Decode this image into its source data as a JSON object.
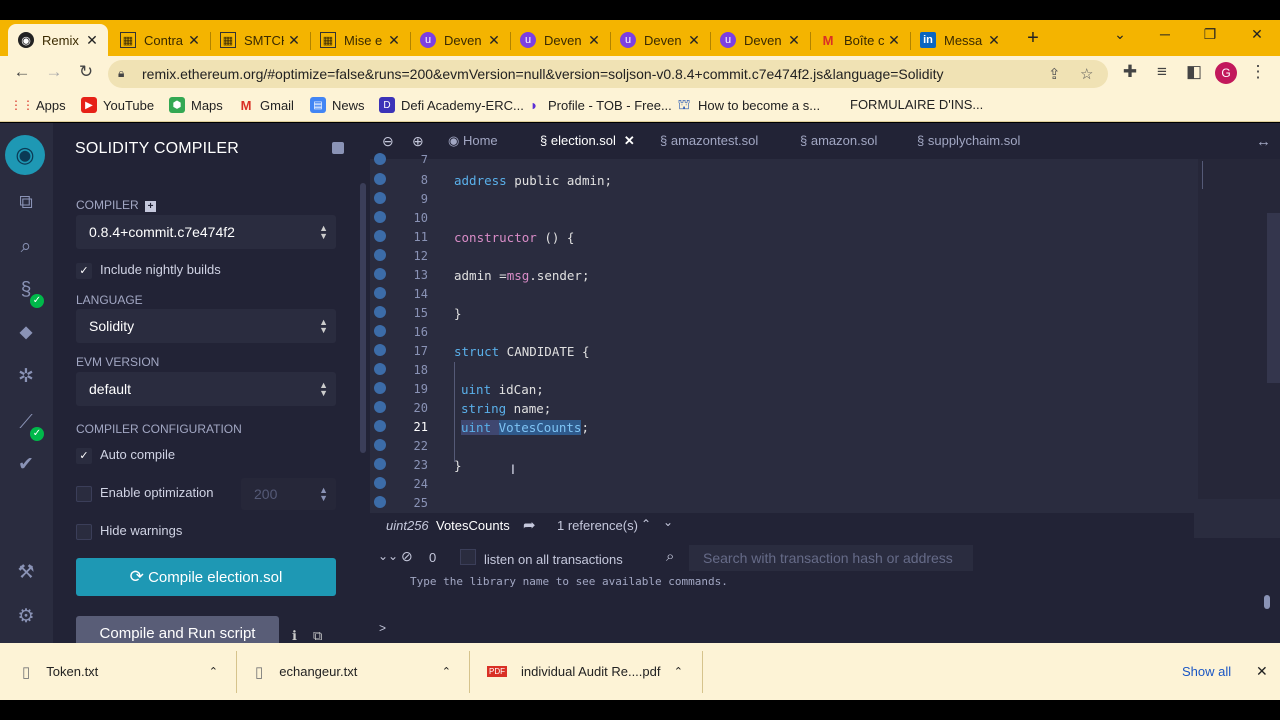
{
  "browser": {
    "tabs": [
      {
        "label": "Remix",
        "icon": "remix-icon",
        "active": true
      },
      {
        "label": "Contra",
        "icon": "doc-icon"
      },
      {
        "label": "SMTCH",
        "icon": "doc-icon"
      },
      {
        "label": "Mise e",
        "icon": "doc-icon"
      },
      {
        "label": "Deven",
        "icon": "purple-icon"
      },
      {
        "label": "Deven",
        "icon": "purple-icon"
      },
      {
        "label": "Deven",
        "icon": "purple-icon"
      },
      {
        "label": "Deven",
        "icon": "purple-icon"
      },
      {
        "label": "Boîte c",
        "icon": "gmail-icon"
      },
      {
        "label": "Messa",
        "icon": "linkedin-icon"
      }
    ],
    "url": "remix.ethereum.org/#optimize=false&runs=200&evmVersion=null&version=soljson-v0.8.4+commit.c7e474f2.js&language=Solidity",
    "avatar_letter": "G",
    "bookmarks": [
      "Apps",
      "YouTube",
      "Maps",
      "Gmail",
      "News",
      "Defi Academy-ERC...",
      "Profile - TOB - Free...",
      "How to become a s...",
      "FORMULAIRE D'INS..."
    ]
  },
  "sidebar": {
    "title": "SOLIDITY COMPILER",
    "compiler_label": "COMPILER",
    "compiler_value": "0.8.4+commit.c7e474f2",
    "nightly_label": "Include nightly builds",
    "language_label": "LANGUAGE",
    "language_value": "Solidity",
    "evm_label": "EVM VERSION",
    "evm_value": "default",
    "config_label": "COMPILER CONFIGURATION",
    "auto_compile_label": "Auto compile",
    "optimization_label": "Enable optimization",
    "runs_value": "200",
    "hide_warnings_label": "Hide warnings",
    "compile_button": "Compile election.sol",
    "run_button": "Compile and Run script"
  },
  "editor": {
    "home_tab": "Home",
    "file_tabs": [
      "election.sol",
      "amazontest.sol",
      "amazon.sol",
      "supplychaim.sol"
    ],
    "active_file": "election.sol",
    "line_numbers": [
      "7",
      "8",
      "9",
      "10",
      "11",
      "12",
      "13",
      "14",
      "15",
      "16",
      "17",
      "18",
      "19",
      "20",
      "21",
      "22",
      "23",
      "24",
      "25"
    ],
    "current_line": "21",
    "code": {
      "l8_a": "address",
      "l8_b": " public admin;",
      "l11_a": "constructor",
      "l11_b": " () {",
      "l13_a": "admin =",
      "l13_b": "msg",
      "l13_c": ".sender;",
      "l15": "}",
      "l17_a": "struct",
      "l17_b": " CANDIDATE {",
      "l19_a": "uint",
      "l19_b": " idCan;",
      "l20_a": "string",
      "l20_b": " name;",
      "l21_a": "uint",
      "l21_b": " ",
      "l21_c": "VotesCounts",
      "l21_d": ";",
      "l23": "}"
    },
    "ref_type": "uint256",
    "ref_name": "VotesCounts",
    "ref_count": "1 reference(s)"
  },
  "terminal": {
    "count": "0",
    "listen_label": "listen on all transactions",
    "search_placeholder": "Search with transaction hash or address",
    "message": "Type the library name to see available commands.",
    "prompt": ">"
  },
  "downloads": {
    "items": [
      "Token.txt",
      "echangeur.txt",
      "individual Audit Re....pdf"
    ],
    "show_all": "Show all"
  },
  "colors": {
    "tab_strip": "#f4b400",
    "remix_bg": "#222336",
    "compile_button": "#1e98b4",
    "keyword": "#5ab0ea",
    "keyword_pink": "#d98cc7"
  }
}
